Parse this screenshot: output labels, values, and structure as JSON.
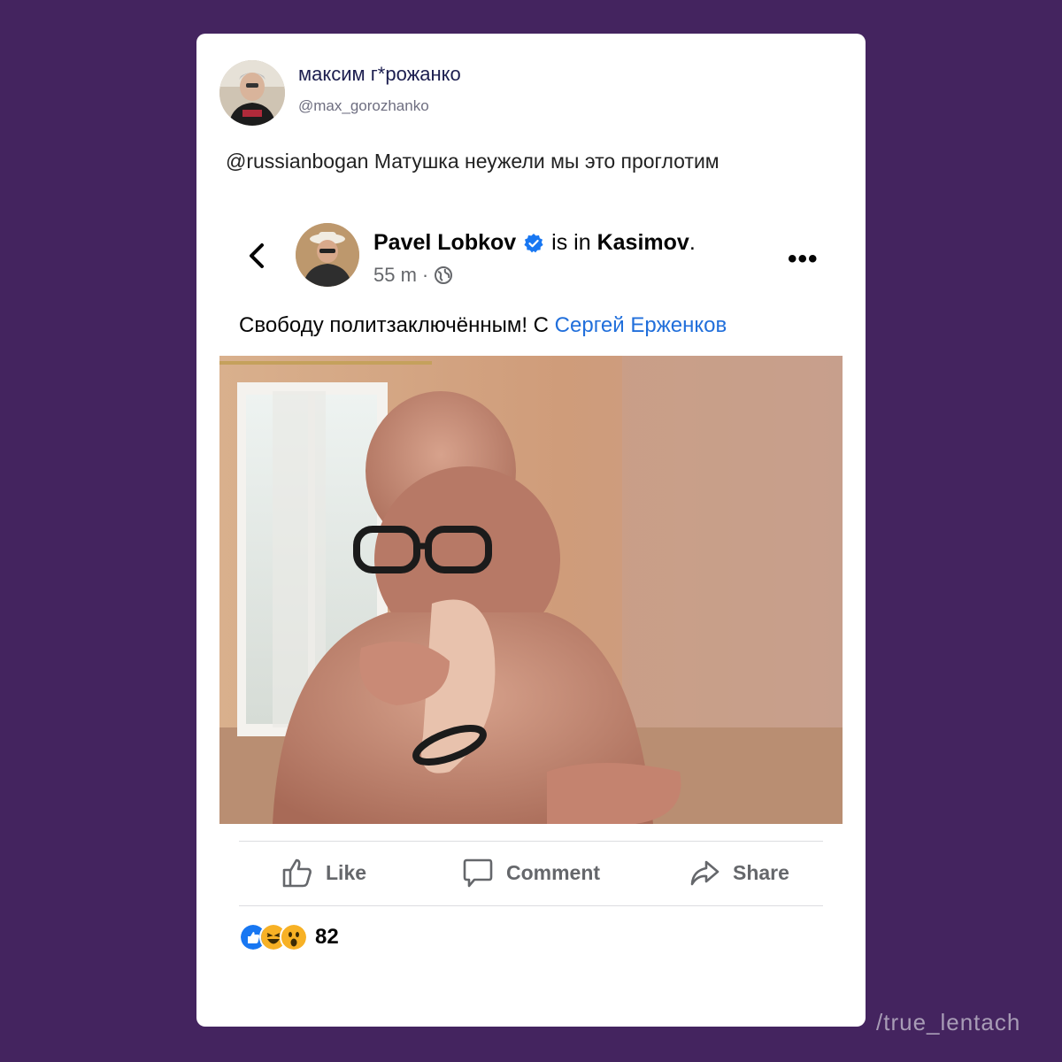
{
  "tweet": {
    "author_name": "максим г*рожанко",
    "author_handle": "@max_gorozhanko",
    "text": "@russianbogan Матушка неужели мы это проглотим"
  },
  "fb_post": {
    "author": "Pavel Lobkov",
    "is_in": "is in",
    "location": "Kasimov",
    "location_suffix": ".",
    "time": "55 m",
    "caption_text": "Свободу политзаключённым! С ",
    "caption_mention": "Сергей Ерженков",
    "actions": {
      "like": "Like",
      "comment": "Comment",
      "share": "Share"
    },
    "reaction_count": "82",
    "reactions": [
      "like",
      "haha",
      "wow"
    ]
  },
  "watermark": "/true_lentach",
  "colors": {
    "background": "#44245f",
    "link": "#216fdb",
    "verified": "#1877f2"
  }
}
